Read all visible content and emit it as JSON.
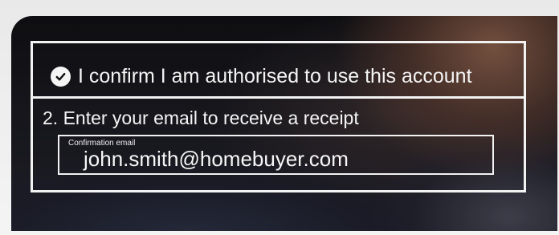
{
  "confirmation": {
    "checked": true,
    "label": "I confirm I am authorised to use this account"
  },
  "email_step": {
    "label": "2. Enter your email to receive a receipt",
    "field_caption": "Confirmation email",
    "field_value": "john.smith@homebuyer.com"
  },
  "icons": {
    "check": "check-circle-icon"
  },
  "colors": {
    "overlay_text": "#f5f5f5",
    "overlay_border": "#f2f2f2"
  }
}
